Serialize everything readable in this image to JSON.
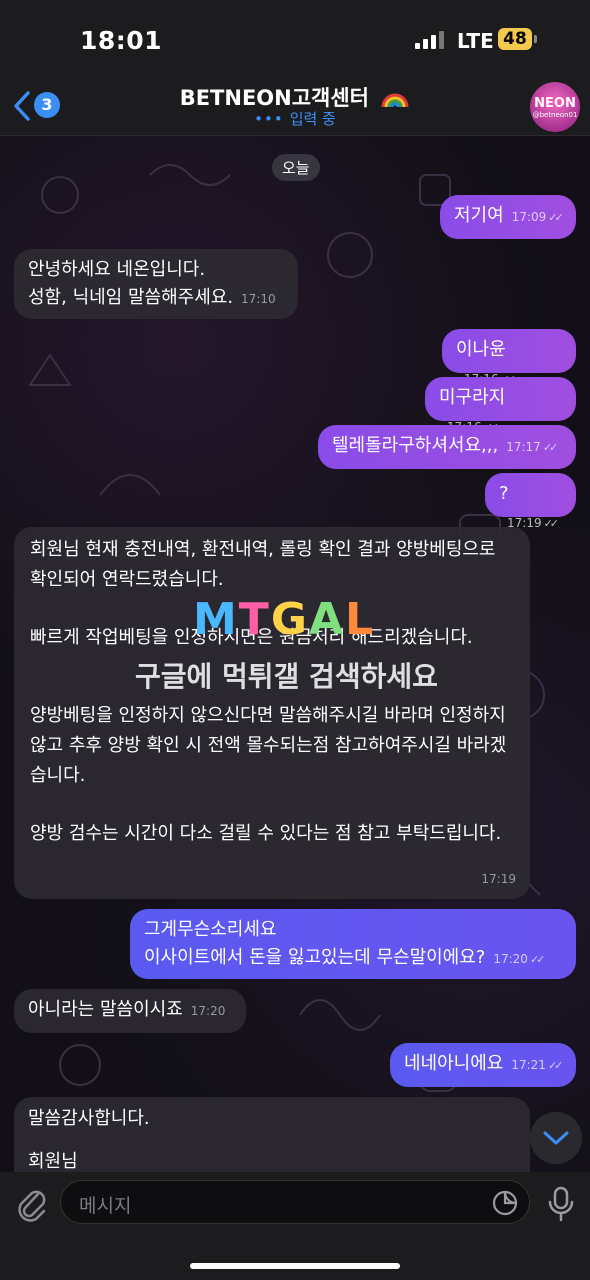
{
  "status": {
    "time": "18:01",
    "network": "LTE",
    "battery": "48"
  },
  "header": {
    "back_count": "3",
    "title": "BETNEON고객센터",
    "subtitle": "입력 중",
    "avatar_text": "NEON",
    "avatar_sub": "@betneon01"
  },
  "date_label": "오늘",
  "messages": [
    {
      "dir": "out",
      "text": "저기여",
      "time": "17:09"
    },
    {
      "dir": "in",
      "lines": [
        "안녕하세요 네온입니다.",
        "성함, 닉네임 말씀해주세요."
      ],
      "time": "17:10"
    },
    {
      "dir": "out",
      "text": "이나윤",
      "time": "17:16"
    },
    {
      "dir": "out",
      "text": "미구라지",
      "time": "17:16"
    },
    {
      "dir": "out",
      "text": "텔레돌라구하셔서요,,,",
      "time": "17:17"
    },
    {
      "dir": "out",
      "text": "?",
      "time": "17:19"
    },
    {
      "dir": "in",
      "paragraphs": [
        "회원님 현재 충전내역, 환전내역, 롤링 확인 결과 양방베팅으로 확인되어 연락드렸습니다.",
        "빠르게 작업베팅을 인정하시면은 원금처리 해드리겠습니다.",
        "양방베팅을 인정하지 않으신다면 말씀해주시길 바라며 인정하지 않고 추후 양방 확인 시 전액 몰수되는점 참고하여주시길 바라겠습니다.",
        "양방 검수는 시간이 다소 걸릴 수 있다는 점 참고 부탁드립니다."
      ],
      "time": "17:19"
    },
    {
      "dir": "out",
      "lines": [
        "그게무슨소리세요",
        "이사이트에서 돈을 잃고있는데 무슨말이에요?"
      ],
      "time": "17:20"
    },
    {
      "dir": "in",
      "text": "아니라는 말씀이시죠",
      "time": "17:20"
    },
    {
      "dir": "out",
      "text": "네네아니에요",
      "time": "17:21"
    },
    {
      "dir": "in",
      "lines": [
        "말씀감사합니다.",
        "",
        "회원님"
      ]
    }
  ],
  "watermark": {
    "logo": [
      "M",
      "T",
      "G",
      "A",
      "L"
    ],
    "text": "구글에 먹튀갤 검색하세요"
  },
  "input": {
    "placeholder": "메시지"
  },
  "colors": {
    "accent": "#3a8ef6",
    "outgoing": "#9a4ee6",
    "incoming": "#2c2932"
  }
}
